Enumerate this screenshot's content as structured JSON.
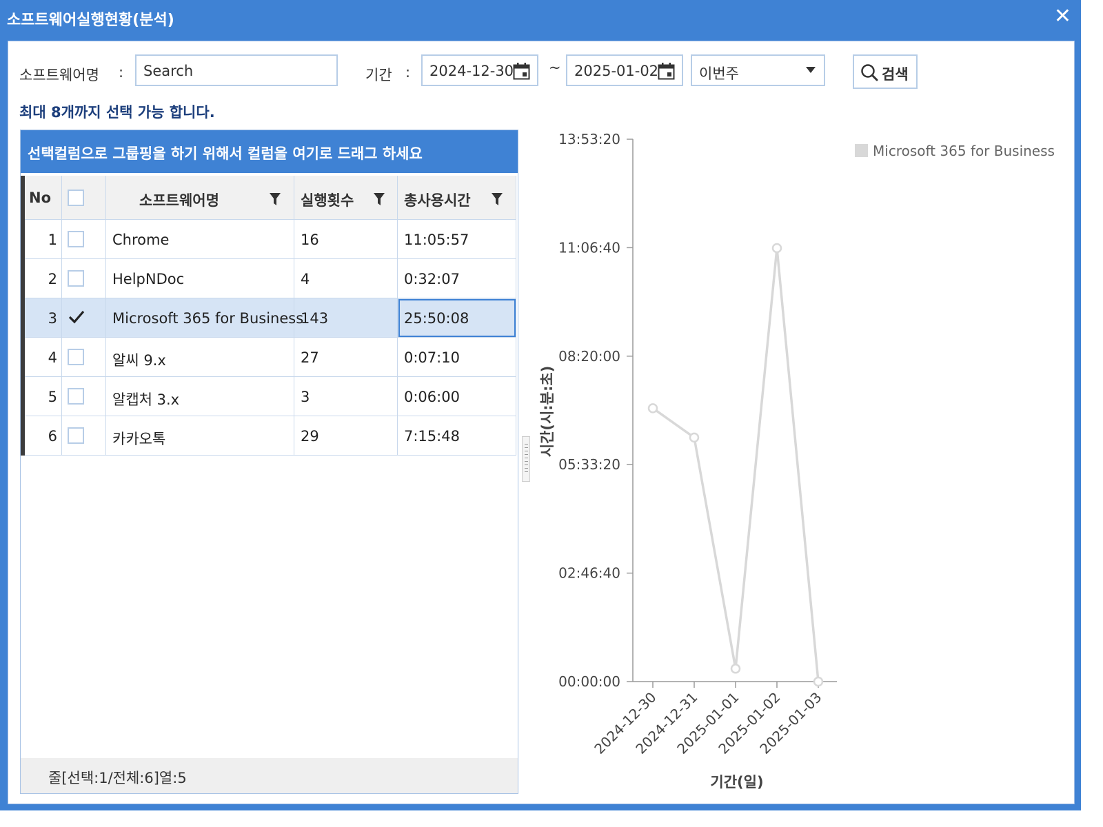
{
  "window": {
    "title": "소프트웨어실행현황(분석)",
    "close_glyph": "✕"
  },
  "filters": {
    "software_label": "소프트웨어명",
    "label_sep": ":",
    "search_value": "Search",
    "period_label": "기간",
    "date_from": "2024-12-30",
    "range_sep": "~",
    "date_to": "2025-01-02",
    "preset_selected": "이번주",
    "search_button": "검색"
  },
  "notice": "최대 8개까지 선택 가능 합니다.",
  "grid": {
    "group_hint": "선택컬럼으로 그룹핑을 하기 위해서 컬럼을 여기로 드래그 하세요",
    "columns": {
      "no": "No",
      "name": "소프트웨어명",
      "runs": "실행횟수",
      "total": "총사용시간"
    },
    "rows": [
      {
        "no": "1",
        "name": "Chrome",
        "runs": "16",
        "total": "11:05:57",
        "checked": false
      },
      {
        "no": "2",
        "name": "HelpNDoc",
        "runs": "4",
        "total": "0:32:07",
        "checked": false
      },
      {
        "no": "3",
        "name": "Microsoft 365 for Business",
        "runs": "143",
        "total": "25:50:08",
        "checked": true
      },
      {
        "no": "4",
        "name": "알씨 9.x",
        "runs": "27",
        "total": "0:07:10",
        "checked": false
      },
      {
        "no": "5",
        "name": "알캡처 3.x",
        "runs": "3",
        "total": "0:06:00",
        "checked": false
      },
      {
        "no": "6",
        "name": "카카오톡",
        "runs": "29",
        "total": "7:15:48",
        "checked": false
      }
    ],
    "status": "줄[선택:1/전체:6]열:5"
  },
  "colors": {
    "accent": "#3f82d4",
    "selected_row": "#d6e4f5",
    "series_line": "#d8d8d8"
  },
  "chart_data": {
    "type": "line",
    "title": "",
    "xlabel": "기간(일)",
    "ylabel": "시간(시:분:초)",
    "categories": [
      "2024-12-30",
      "2024-12-31",
      "2025-01-01",
      "2025-01-02",
      "2025-01-03"
    ],
    "series": [
      {
        "name": "Microsoft 365 for Business",
        "values": [
          7,
          6.25,
          0.33,
          11.1,
          0
        ]
      }
    ],
    "y_unit": "hours",
    "ylim": [
      0,
      13.8889
    ],
    "yticks": [
      "00:00:00",
      "02:46:40",
      "05:33:20",
      "08:20:00",
      "11:06:40",
      "13:53:20"
    ],
    "grid": false,
    "legend": "top-right"
  }
}
